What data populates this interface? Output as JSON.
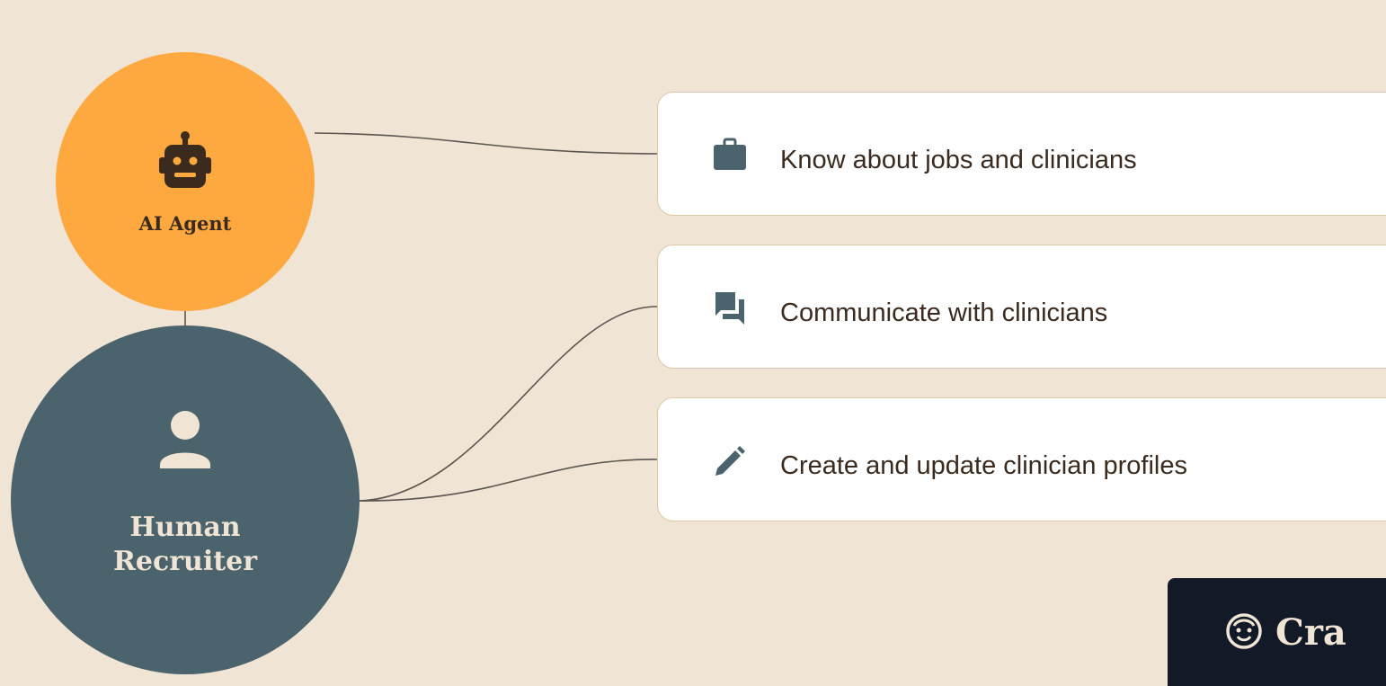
{
  "nodes": {
    "ai_agent": {
      "label": "AI Agent",
      "icon": "robot-icon",
      "color": "#fda940"
    },
    "human_recruiter": {
      "label": "Human\nRecruiter",
      "icon": "person-icon",
      "color": "#4a636d"
    }
  },
  "capabilities": [
    {
      "label": "Know about jobs and clinicians",
      "icon": "briefcase-icon"
    },
    {
      "label": "Communicate with clinicians",
      "icon": "chat-bubbles-icon"
    },
    {
      "label": "Create and update clinician profiles",
      "icon": "pencil-icon"
    }
  ],
  "brand": {
    "name": "Cra",
    "icon": "smiley-face-icon"
  },
  "colors": {
    "background": "#f0e4d4",
    "card_border": "#dcc9a7",
    "icon": "#4a636d",
    "text": "#3b2a1e",
    "connector": "#5b5550",
    "badge": "#121a28"
  }
}
